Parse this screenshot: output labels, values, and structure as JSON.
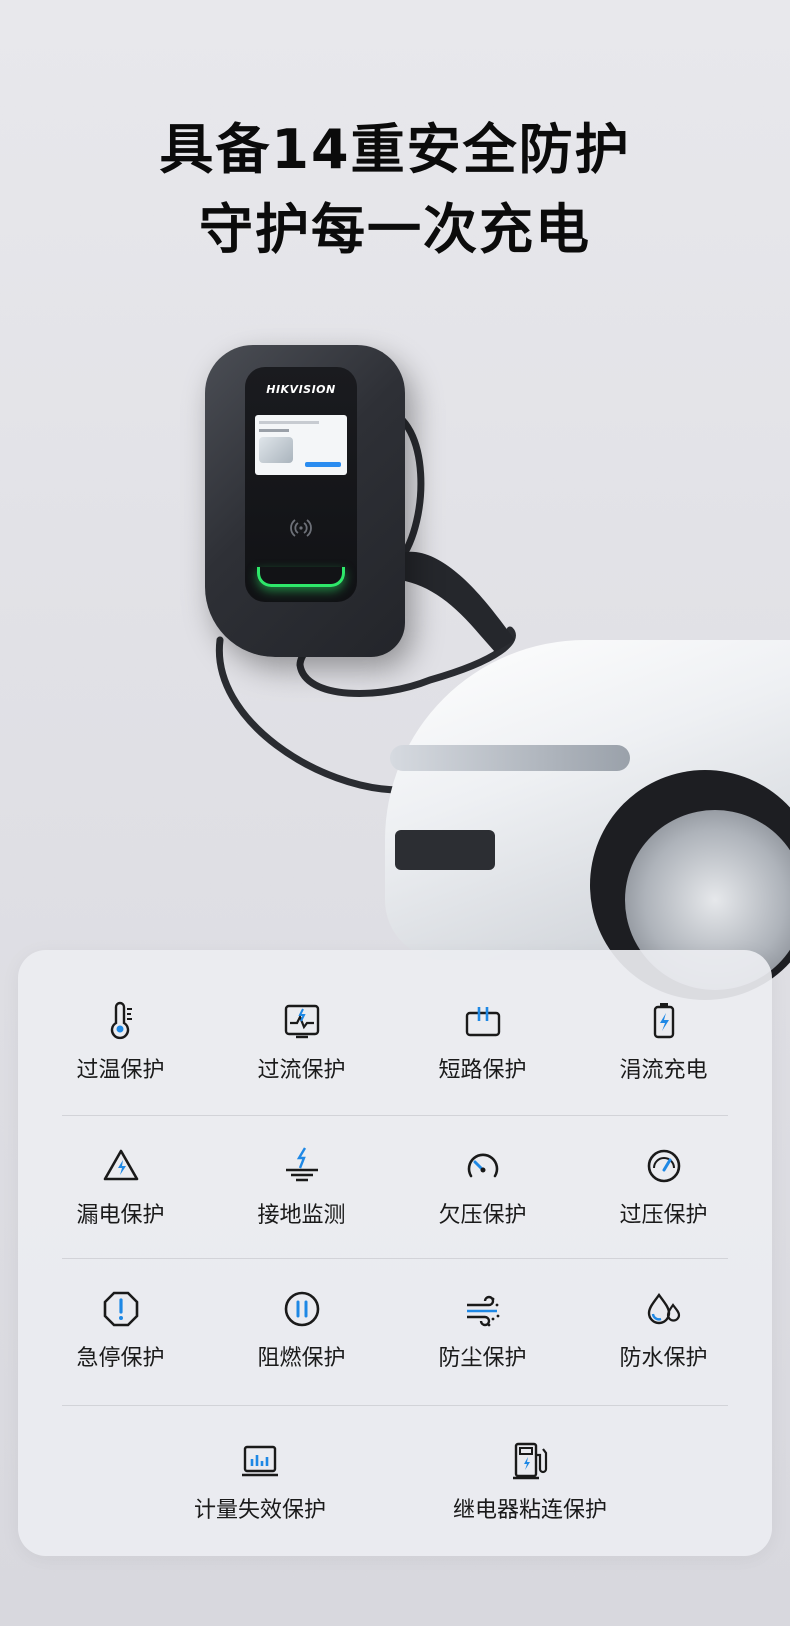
{
  "headline": {
    "line1": "具备14重安全防护",
    "line2": "守护每一次充电"
  },
  "charger": {
    "brand": "HIKVISION"
  },
  "colors": {
    "icon_dark": "#1a1a1a",
    "icon_accent": "#1e88e5",
    "led": "#2ee86a"
  },
  "features": {
    "row1": [
      {
        "label": "过温保护",
        "icon": "thermometer-icon"
      },
      {
        "label": "过流保护",
        "icon": "current-wave-icon"
      },
      {
        "label": "短路保护",
        "icon": "short-circuit-icon"
      },
      {
        "label": "涓流充电",
        "icon": "battery-charge-icon"
      }
    ],
    "row2": [
      {
        "label": "漏电保护",
        "icon": "leakage-warning-icon"
      },
      {
        "label": "接地监测",
        "icon": "grounding-icon"
      },
      {
        "label": "欠压保护",
        "icon": "low-gauge-icon"
      },
      {
        "label": "过压保护",
        "icon": "high-gauge-icon"
      }
    ],
    "row3": [
      {
        "label": "急停保护",
        "icon": "emergency-stop-icon"
      },
      {
        "label": "阻燃保护",
        "icon": "flame-retardant-icon"
      },
      {
        "label": "防尘保护",
        "icon": "dust-icon"
      },
      {
        "label": "防水保护",
        "icon": "water-drop-icon"
      }
    ],
    "row4": [
      {
        "label": "计量失效保护",
        "icon": "meter-icon"
      },
      {
        "label": "继电器粘连保护",
        "icon": "charging-station-icon"
      }
    ]
  }
}
